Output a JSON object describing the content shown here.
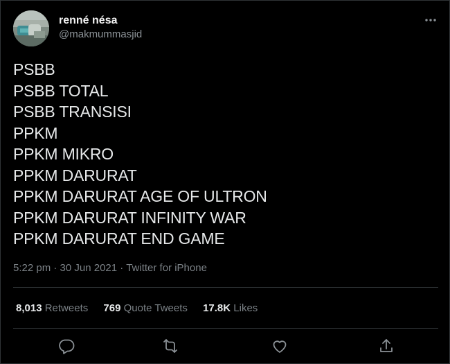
{
  "user": {
    "display_name": "renné nésa",
    "handle": "@makmummasjid"
  },
  "tweet": {
    "lines": [
      "PSBB",
      "PSBB TOTAL",
      "PSBB TRANSISI",
      "PPKM",
      "PPKM MIKRO",
      "PPKM DARURAT",
      "PPKM DARURAT AGE OF ULTRON",
      "PPKM DARURAT INFINITY WAR",
      "PPKM DARURAT END GAME"
    ],
    "time": "5:22 pm",
    "separator": "·",
    "date": "30 Jun 2021",
    "source": "Twitter for iPhone"
  },
  "stats": {
    "retweets_count": "8,013",
    "retweets_label": "Retweets",
    "quotes_count": "769",
    "quotes_label": "Quote Tweets",
    "likes_count": "17.8K",
    "likes_label": "Likes"
  },
  "icons": {
    "more": "more-horizontal-icon",
    "reply": "reply-icon",
    "retweet": "retweet-icon",
    "like": "heart-icon",
    "share": "share-icon"
  },
  "colors": {
    "background": "#000000",
    "text": "#e7e9ea",
    "secondary": "#7b8186",
    "divider": "#2f3336"
  }
}
